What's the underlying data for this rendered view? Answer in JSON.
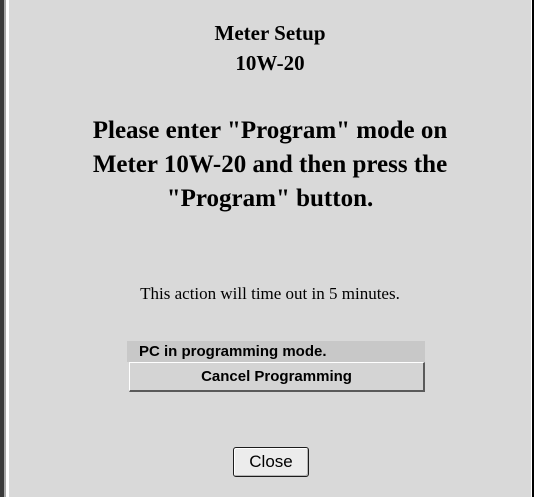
{
  "dialog": {
    "title_line1": "Meter Setup",
    "title_line2": "10W-20",
    "instruction_line1": "Please enter \"Program\" mode on",
    "instruction_line2": "Meter 10W-20 and then press the",
    "instruction_line3": "\"Program\" button.",
    "timeout_text": "This action will time out in 5 minutes.",
    "status_text": "PC in programming mode.",
    "cancel_label": "Cancel Programming",
    "close_label": "Close"
  },
  "colors": {
    "panel_background": "#d9d9d9",
    "status_background": "#c8c8c8",
    "left_border": "#3a3a3a"
  }
}
